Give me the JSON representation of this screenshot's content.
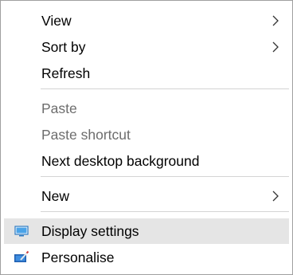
{
  "menu": {
    "items": [
      {
        "label": "View",
        "submenu": true,
        "enabled": true
      },
      {
        "label": "Sort by",
        "submenu": true,
        "enabled": true
      },
      {
        "label": "Refresh",
        "submenu": false,
        "enabled": true
      },
      {
        "label": "Paste",
        "submenu": false,
        "enabled": false
      },
      {
        "label": "Paste shortcut",
        "submenu": false,
        "enabled": false
      },
      {
        "label": "Next desktop background",
        "submenu": false,
        "enabled": true
      },
      {
        "label": "New",
        "submenu": true,
        "enabled": true
      },
      {
        "label": "Display settings",
        "submenu": false,
        "enabled": true,
        "icon": "display-icon",
        "highlighted": true
      },
      {
        "label": "Personalise",
        "submenu": false,
        "enabled": true,
        "icon": "personalise-icon"
      }
    ]
  },
  "colors": {
    "highlight": "#e5e5e5",
    "disabled_text": "#6d6d6d",
    "separator": "#d4d4d4",
    "border": "#a0a0a0"
  }
}
